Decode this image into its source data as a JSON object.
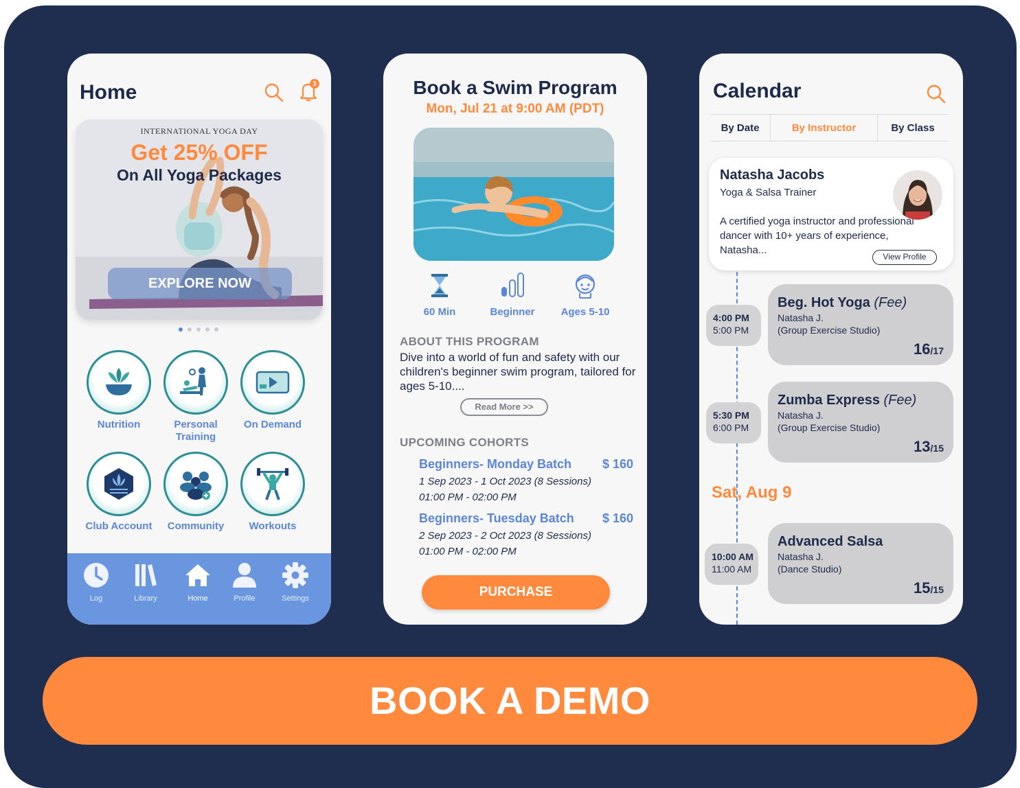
{
  "home": {
    "title": "Home",
    "notification_count": "3",
    "banner": {
      "kicker": "INTERNATIONAL YOGA DAY",
      "offer": "Get 25% OFF",
      "subtitle": "On All Yoga Packages",
      "button": "EXPLORE NOW",
      "slide_count": 5,
      "active_slide": 1
    },
    "tiles": [
      {
        "label": "Nutrition",
        "icon": "bowl-leaf-icon"
      },
      {
        "label": "Personal Training",
        "icon": "trainer-icon"
      },
      {
        "label": "On Demand",
        "icon": "video-play-icon"
      },
      {
        "label": "Club Account",
        "icon": "club-emblem-icon"
      },
      {
        "label": "Community",
        "icon": "community-icon"
      },
      {
        "label": "Workouts",
        "icon": "weightlifter-icon"
      }
    ],
    "tabs": [
      {
        "label": "Log",
        "icon": "clock-icon"
      },
      {
        "label": "Library",
        "icon": "books-icon"
      },
      {
        "label": "Home",
        "icon": "house-icon",
        "active": true
      },
      {
        "label": "Profile",
        "icon": "person-icon"
      },
      {
        "label": "Settings",
        "icon": "gear-icon"
      }
    ]
  },
  "swim": {
    "title": "Book a Swim Program",
    "datetime": "Mon, Jul 21 at 9:00 AM (PDT)",
    "stats": [
      {
        "label": "60 Min",
        "icon": "hourglass-icon"
      },
      {
        "label": "Beginner",
        "icon": "level-bars-icon"
      },
      {
        "label": "Ages 5-10",
        "icon": "child-face-icon"
      }
    ],
    "about_heading": "ABOUT THIS PROGRAM",
    "about_text": "Dive into a world of fun and safety with our children's beginner swim program, tailored for ages 5-10....",
    "read_more": "Read More >>",
    "cohorts_heading": "UPCOMING COHORTS",
    "cohorts": [
      {
        "name": "Beginners- Monday Batch",
        "price": "$ 160",
        "dates": "1 Sep 2023 - 1 Oct 2023 (8 Sessions)",
        "time": "01:00 PM - 02:00 PM"
      },
      {
        "name": "Beginners- Tuesday Batch",
        "price": "$ 160",
        "dates": "2 Sep 2023 - 2 Oct 2023 (8 Sessions)",
        "time": "01:00 PM - 02:00 PM"
      }
    ],
    "purchase": "PURCHASE"
  },
  "calendar": {
    "title": "Calendar",
    "segments": [
      "By Date",
      "By Instructor",
      "By Class"
    ],
    "active_segment": 1,
    "instructor": {
      "name": "Natasha Jacobs",
      "role": "Yoga & Salsa Trainer",
      "bio": "A certified yoga instructor and professional dancer with 10+ years of experience, Natasha...",
      "view_profile": "View Profile"
    },
    "classes": [
      {
        "start": "4:00 PM",
        "end": "5:00 PM",
        "name": "Beg. Hot Yoga",
        "fee": "(Fee)",
        "instructor": "Natasha J.",
        "location": "(Group Exercise Studio)",
        "booked": "16",
        "capacity": "/17"
      },
      {
        "start": "5:30 PM",
        "end": "6:00 PM",
        "name": "Zumba Express",
        "fee": "(Fee)",
        "instructor": "Natasha J.",
        "location": "(Group Exercise Studio)",
        "booked": "13",
        "capacity": "/15"
      }
    ],
    "day_heading": "Sat, Aug 9",
    "day_classes": [
      {
        "start": "10:00 AM",
        "end": "11:00 AM",
        "name": "Advanced Salsa",
        "fee": "",
        "instructor": "Natasha J.",
        "location": "(Dance Studio)",
        "booked": "15",
        "capacity": "/15"
      }
    ]
  },
  "cta": "BOOK A DEMO",
  "colors": {
    "navy": "#1f2d4e",
    "orange": "#ff8a3d",
    "blue": "#5b86d6",
    "tabbar": "#6a96df"
  }
}
